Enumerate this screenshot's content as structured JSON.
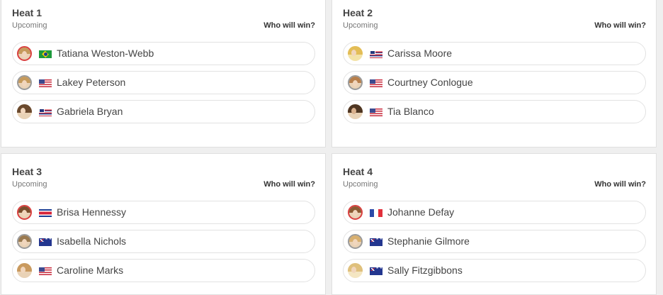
{
  "who_label": "Who will win?",
  "heats": [
    {
      "title": "Heat 1",
      "status": "Upcoming",
      "surfers": [
        {
          "name": "Tatiana Weston-Webb",
          "flag": "brazil-flag"
        },
        {
          "name": "Lakey Peterson",
          "flag": "usa-flag"
        },
        {
          "name": "Gabriela Bryan",
          "flag": "hawaii-flag"
        }
      ]
    },
    {
      "title": "Heat 2",
      "status": "Upcoming",
      "surfers": [
        {
          "name": "Carissa Moore",
          "flag": "hawaii-flag"
        },
        {
          "name": "Courtney Conlogue",
          "flag": "usa-flag"
        },
        {
          "name": "Tia Blanco",
          "flag": "usa-flag"
        }
      ]
    },
    {
      "title": "Heat 3",
      "status": "Upcoming",
      "surfers": [
        {
          "name": "Brisa Hennessy",
          "flag": "costa-rica-flag"
        },
        {
          "name": "Isabella Nichols",
          "flag": "australia-flag"
        },
        {
          "name": "Caroline Marks",
          "flag": "usa-flag"
        }
      ]
    },
    {
      "title": "Heat 4",
      "status": "Upcoming",
      "surfers": [
        {
          "name": "Johanne Defay",
          "flag": "france-flag"
        },
        {
          "name": "Stephanie Gilmore",
          "flag": "australia-flag"
        },
        {
          "name": "Sally Fitzgibbons",
          "flag": "australia-flag"
        }
      ]
    }
  ]
}
